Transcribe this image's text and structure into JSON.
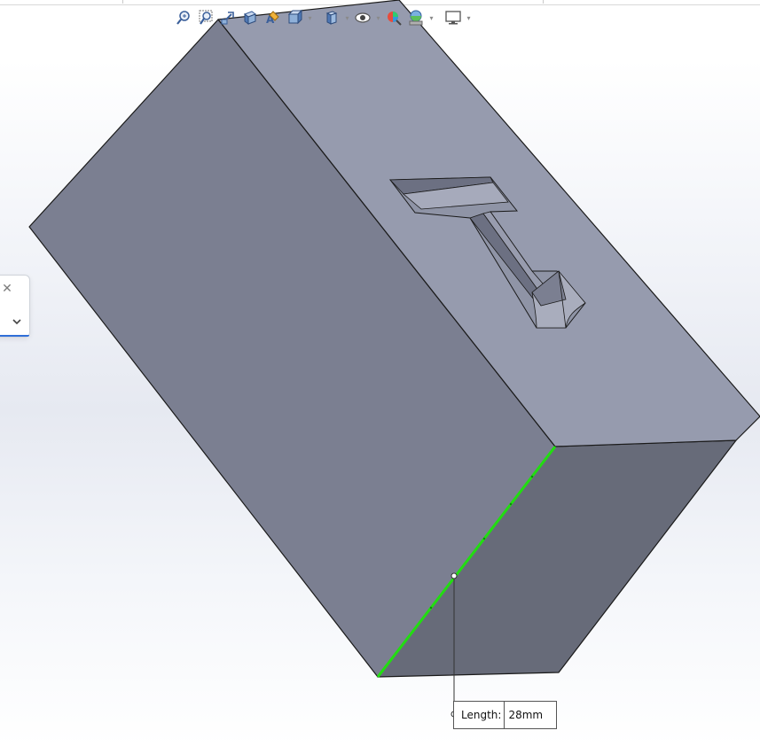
{
  "toolbar": {
    "buttons": [
      {
        "icon": "zoom-to-fit-icon"
      },
      {
        "icon": "zoom-to-area-icon"
      },
      {
        "icon": "previous-view-icon"
      },
      {
        "icon": "section-view-icon"
      },
      {
        "icon": "dynamic-annotation-views-icon"
      },
      {
        "icon": "view-orientation-icon"
      },
      {
        "icon": "display-style-icon"
      },
      {
        "icon": "hide-show-items-icon"
      },
      {
        "icon": "edit-appearance-icon"
      },
      {
        "icon": "apply-scene-icon"
      },
      {
        "icon": "view-settings-icon"
      }
    ]
  },
  "flyout": {
    "close_glyph": "✕"
  },
  "measure": {
    "label": "Length:",
    "value": "28mm"
  },
  "colors": {
    "top_face": "#969bae",
    "front_face": "#7b7f91",
    "right_face": "#676b79",
    "selected_edge": "#22dd11",
    "pocket_floor": "#8f94a6",
    "pocket_wall_dark": "#6c7082",
    "pocket_wall_light": "#a9adbd"
  }
}
